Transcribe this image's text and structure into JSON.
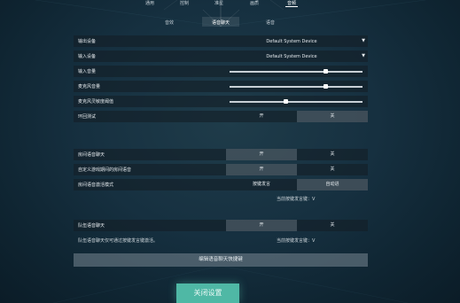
{
  "top_tabs": [
    {
      "label": "通用",
      "active": false
    },
    {
      "label": "控制",
      "active": false
    },
    {
      "label": "准星",
      "active": false
    },
    {
      "label": "画质",
      "active": false
    },
    {
      "label": "音频",
      "active": true
    }
  ],
  "sub_tabs": [
    {
      "label": "音效",
      "active": false
    },
    {
      "label": "语音聊天",
      "active": true
    },
    {
      "label": "语音",
      "active": false
    }
  ],
  "devices": {
    "output_label": "输出设备",
    "output_value": "Default System Device",
    "input_label": "输入设备",
    "input_value": "Default System Device"
  },
  "volumes": {
    "input_label": "输入音量",
    "input_level": 0.72,
    "output_label": "麦克风音量",
    "output_level": 0.72,
    "threshold_label": "麦克风灵敏度阈值",
    "threshold_level": 0.42
  },
  "loopback": {
    "label": "环回测试",
    "on": "开",
    "off": "关",
    "selected": "off"
  },
  "party": {
    "voice_label": "房间语音聊天",
    "voice_on": "开",
    "voice_off": "关",
    "auto_join_label": "自定义游戏期间的房间语音",
    "auto_join_on": "开",
    "auto_join_off": "关",
    "mode_label": "房间语音激活模式",
    "mode_ptt": "按键发言",
    "mode_auto": "自动进",
    "current_key_label": "当前按键发言键：",
    "current_key_value": "V"
  },
  "team": {
    "voice_label": "队伍语音聊天",
    "voice_on": "开",
    "voice_off": "关",
    "note_label": "队伍语音聊天仅可通过按键发言键激活。",
    "current_key_label": "当前按键发言键：",
    "current_key_value": "V"
  },
  "keybind_button": "编辑语音聊天快捷键",
  "close_button": "关闭设置"
}
